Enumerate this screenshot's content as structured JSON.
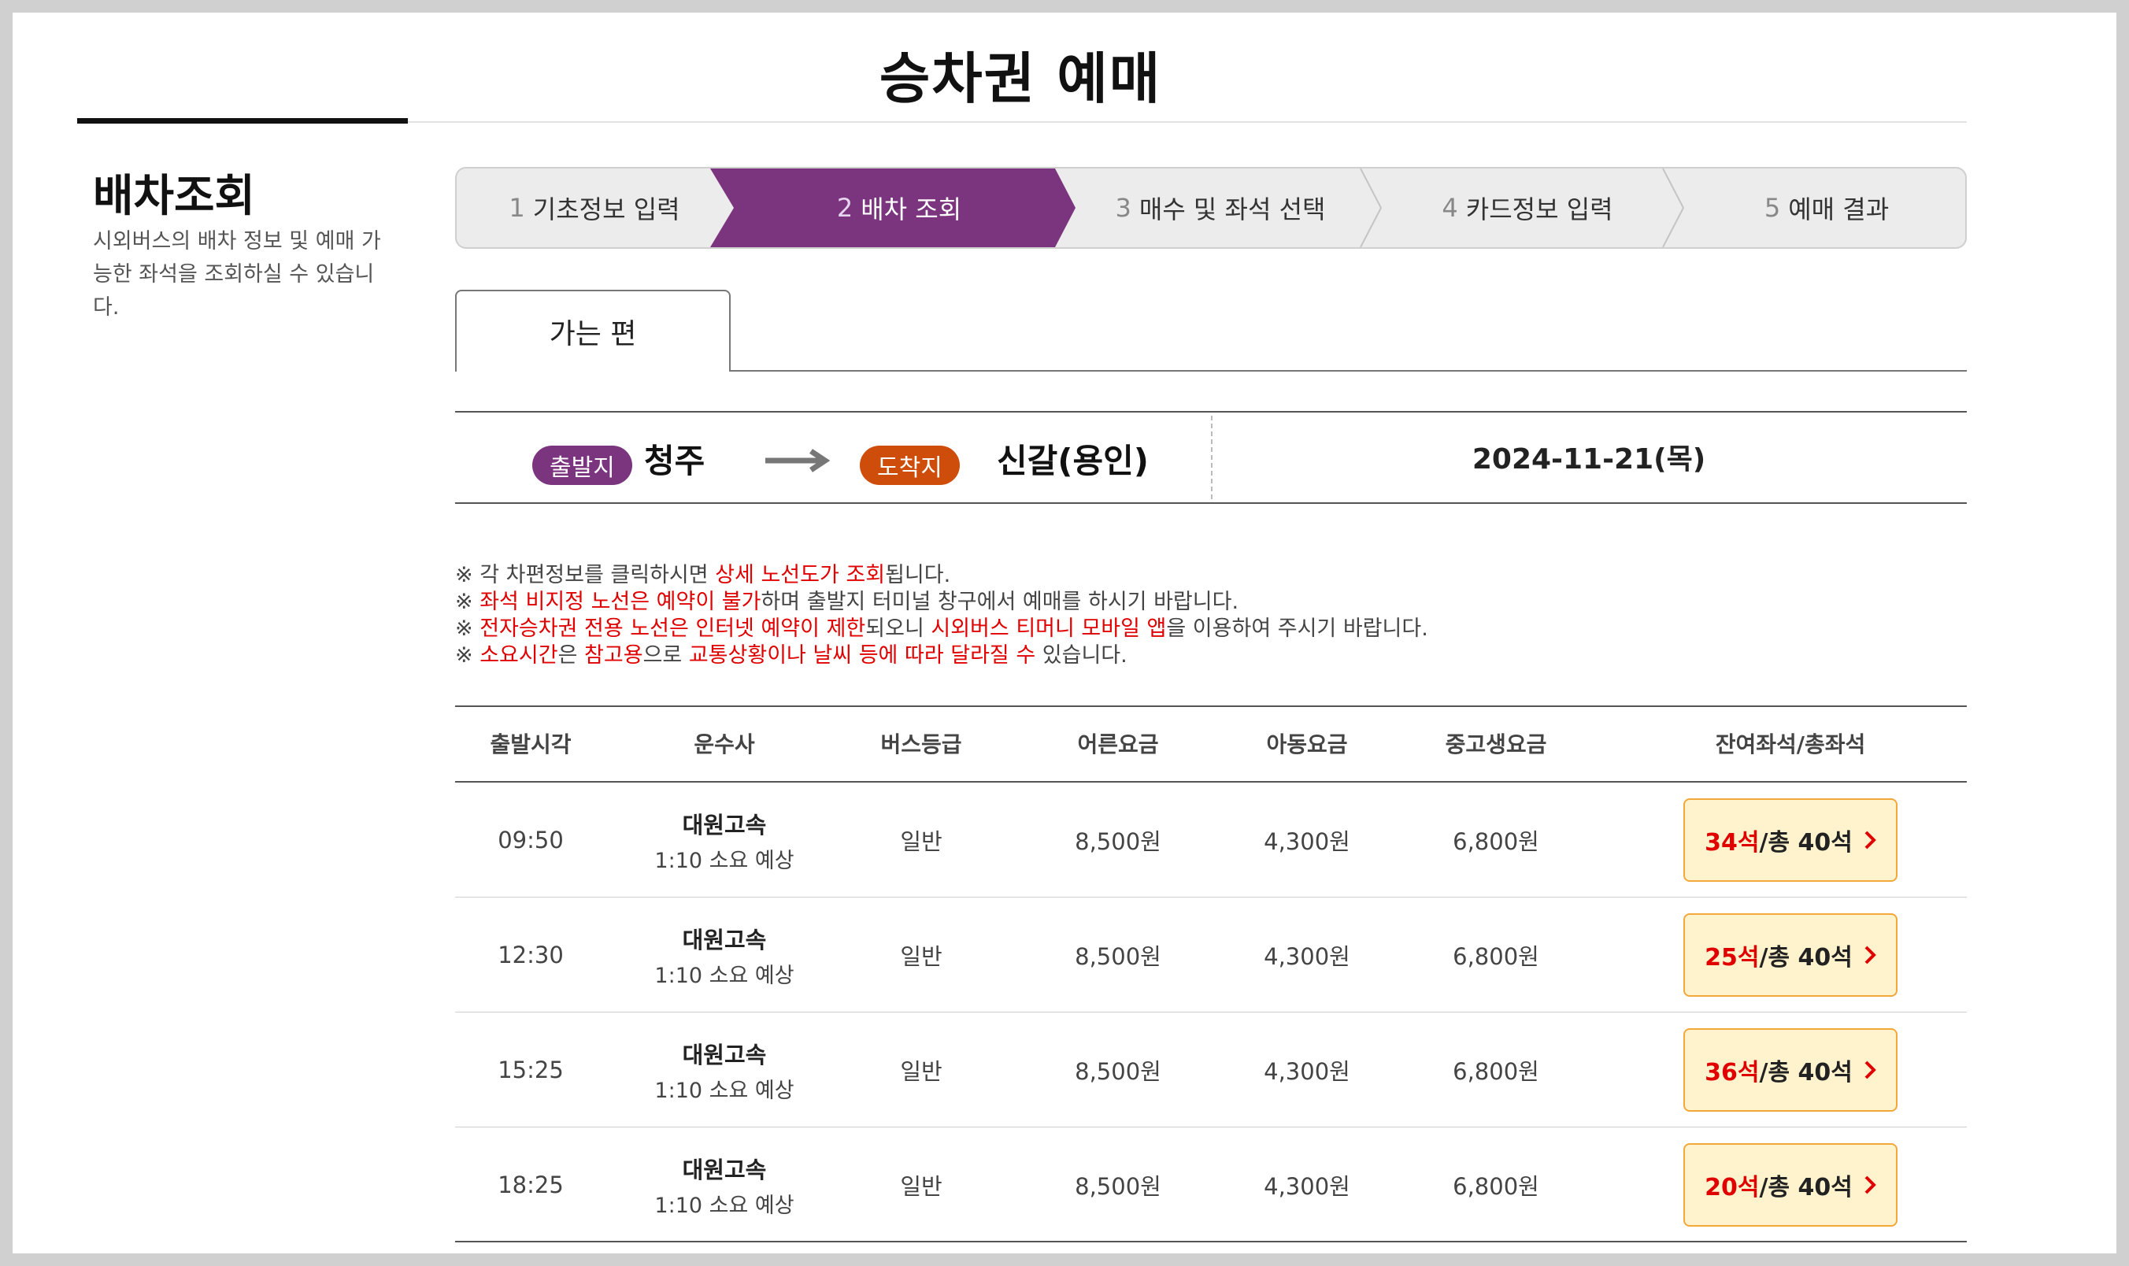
{
  "page": {
    "title": "승차권 예매"
  },
  "sidebar": {
    "title": "배차조회",
    "description": "시외버스의 배차 정보 및 예매 가능한 좌석을 조회하실 수 있습니다."
  },
  "steps": [
    {
      "num": "1",
      "label": "기초정보 입력"
    },
    {
      "num": "2",
      "label": "배차 조회"
    },
    {
      "num": "3",
      "label": "매수 및 좌석 선택"
    },
    {
      "num": "4",
      "label": "카드정보 입력"
    },
    {
      "num": "5",
      "label": "예매 결과"
    }
  ],
  "active_step": 2,
  "tab": {
    "label": "가는 편"
  },
  "route": {
    "departure_label": "출발지",
    "departure_city": "청주",
    "arrival_label": "도착지",
    "arrival_city": "신갈(용인)",
    "date": "2024-11-21(목)"
  },
  "notices": [
    [
      {
        "t": "※ 각 차편정보를 클릭하시면 ",
        "h": false
      },
      {
        "t": "상세 노선도가 조회",
        "h": true
      },
      {
        "t": "됩니다.",
        "h": false
      }
    ],
    [
      {
        "t": "※ ",
        "h": false
      },
      {
        "t": "좌석 비지정 노선은 예약이 불가",
        "h": true
      },
      {
        "t": "하며 출발지 터미널 창구에서 예매를 하시기 바랍니다.",
        "h": false
      }
    ],
    [
      {
        "t": "※ ",
        "h": false
      },
      {
        "t": "전자승차권 전용 노선은 인터넷 예약이 제한",
        "h": true
      },
      {
        "t": "되오니 ",
        "h": false
      },
      {
        "t": "시외버스 티머니 모바일 앱",
        "h": true
      },
      {
        "t": "을 이용하여 주시기 바랍니다.",
        "h": false
      }
    ],
    [
      {
        "t": "※ ",
        "h": false
      },
      {
        "t": "소요시간",
        "h": true
      },
      {
        "t": "은 ",
        "h": false
      },
      {
        "t": "참고용",
        "h": true
      },
      {
        "t": "으로 ",
        "h": false
      },
      {
        "t": "교통상황이나 날씨 등에 따라 달라질 수",
        "h": true
      },
      {
        "t": " 있습니다.",
        "h": false
      }
    ]
  ],
  "table": {
    "headers": [
      "출발시각",
      "운수사",
      "버스등급",
      "어른요금",
      "아동요금",
      "중고생요금",
      "잔여좌석/총좌석"
    ],
    "rows": [
      {
        "time": "09:50",
        "company": "대원고속",
        "duration": "1:10 소요 예상",
        "grade": "일반",
        "adult": "8,500원",
        "child": "4,300원",
        "student": "6,800원",
        "remaining": "34석",
        "total": " /총 40석"
      },
      {
        "time": "12:30",
        "company": "대원고속",
        "duration": "1:10 소요 예상",
        "grade": "일반",
        "adult": "8,500원",
        "child": "4,300원",
        "student": "6,800원",
        "remaining": "25석",
        "total": " /총 40석"
      },
      {
        "time": "15:25",
        "company": "대원고속",
        "duration": "1:10 소요 예상",
        "grade": "일반",
        "adult": "8,500원",
        "child": "4,300원",
        "student": "6,800원",
        "remaining": "36석",
        "total": " /총 40석"
      },
      {
        "time": "18:25",
        "company": "대원고속",
        "duration": "1:10 소요 예상",
        "grade": "일반",
        "adult": "8,500원",
        "child": "4,300원",
        "student": "6,800원",
        "remaining": "20석",
        "total": " /총 40석"
      }
    ]
  },
  "icons": {
    "route_arrow": "right-arrow-icon",
    "seat_chevron": "chevron-right-icon"
  },
  "colors": {
    "accent_purple": "#7b347e",
    "accent_orange": "#cf4d0a",
    "highlight_red": "#e00000",
    "seat_button_bg": "#fff3cd",
    "seat_button_border": "#f2a83b"
  }
}
